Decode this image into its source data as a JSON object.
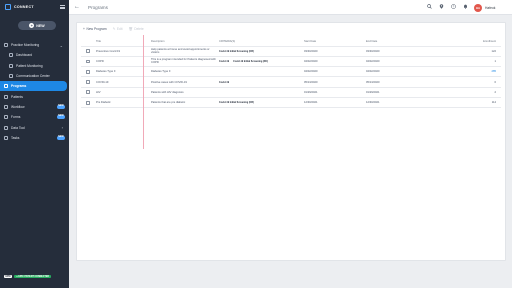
{
  "app": {
    "brand": "CONNECT"
  },
  "sidebar": {
    "new_button": "NEW",
    "items": [
      {
        "label": "Practice Monitoring",
        "icon": "monitor-icon",
        "chevron": "⌄",
        "sub": false,
        "active": false,
        "badge": ""
      },
      {
        "label": "Dashboard",
        "icon": "dashboard-icon",
        "sub": true,
        "active": false,
        "badge": ""
      },
      {
        "label": "Patient Monitoring",
        "icon": "patient-monitor-icon",
        "sub": true,
        "active": false,
        "badge": ""
      },
      {
        "label": "Communication Center",
        "icon": "chat-icon",
        "sub": true,
        "active": false,
        "badge": ""
      },
      {
        "label": "Programs",
        "icon": "programs-icon",
        "sub": false,
        "active": true,
        "badge": ""
      },
      {
        "label": "Patients",
        "icon": "patients-icon",
        "sub": false,
        "active": false,
        "badge": ""
      },
      {
        "label": "Workflow",
        "icon": "workflow-icon",
        "sub": false,
        "active": false,
        "badge": "NEW"
      },
      {
        "label": "Forms",
        "icon": "forms-icon",
        "sub": false,
        "active": false,
        "badge": "NEW"
      },
      {
        "label": "Data Tool",
        "icon": "data-tool-icon",
        "chevron": "›",
        "sub": false,
        "active": false,
        "badge": ""
      },
      {
        "label": "Tasks",
        "icon": "tasks-icon",
        "sub": false,
        "active": false,
        "badge": "NEW"
      }
    ],
    "footer_tag": "EPIC",
    "footer_status": "● EPIC PATIENT CONNECTED"
  },
  "header": {
    "title": "Programs",
    "back_icon": "←",
    "user_initials": "HA",
    "user_name": "Hafeok"
  },
  "toolbar": {
    "new_label": "New Program",
    "edit_label": "Edit",
    "delete_label": "Delete"
  },
  "table": {
    "headers": {
      "title": "Title",
      "description": "Description",
      "criteria": "CRITERIA(S)",
      "start": "Start Date",
      "end": "End Date",
      "enrollment": "Enrollment"
    },
    "rows": [
      {
        "title": "Preventive Covid 19",
        "description": "Help patients at home and avoid appointments or visitors",
        "criteria": [
          "Covid-19 Initial Screening (CR)"
        ],
        "start": "03/30/2020",
        "end": "03/30/2020",
        "enrollment": "122",
        "link": false
      },
      {
        "title": "COPD",
        "description": "This is a program intended for Patients diagnosed with COPD",
        "criteria": [
          "Covid-19",
          "Covid-19 Initial Screening (DC)"
        ],
        "start": "04/02/2020",
        "end": "04/02/2020",
        "enrollment": "1",
        "link": false
      },
      {
        "title": "Diabetes Type II",
        "description": "Diabetes Type II",
        "criteria": [],
        "start": "04/02/2020",
        "end": "04/02/2020",
        "enrollment": "285",
        "link": true
      },
      {
        "title": "COVID-19",
        "description": "Positive cases with COVID-19",
        "criteria": [
          "Covid-19"
        ],
        "start": "05/13/2020",
        "end": "05/13/2020",
        "enrollment": "0",
        "link": false
      },
      {
        "title": "HIV",
        "description": "Patients with HIV diagnosis",
        "criteria": [],
        "start": "01/29/2021",
        "end": "01/29/2021",
        "enrollment": "2",
        "link": false
      },
      {
        "title": "Pre Diabetic",
        "description": "Patients that are pre diabetic",
        "criteria": [
          "Covid-19 Initial Screening (CR)"
        ],
        "start": "12/30/2021",
        "end": "12/30/2021",
        "enrollment": "114",
        "link": false
      }
    ]
  }
}
